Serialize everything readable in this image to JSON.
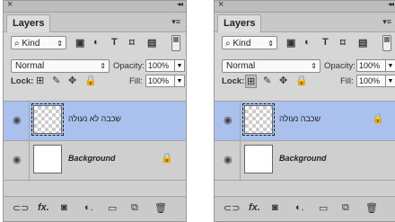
{
  "panels": [
    {
      "title": "Layers",
      "kind_label": "Kind",
      "blend_mode": "Normal",
      "opacity_label": "Opacity:",
      "opacity_value": "100%",
      "lock_label": "Lock:",
      "fill_label": "Fill:",
      "fill_value": "100%",
      "layers": [
        {
          "name": "שכבה לא נעולה",
          "selected": true,
          "locked": false
        },
        {
          "name": "Background",
          "selected": false,
          "locked": true
        }
      ]
    },
    {
      "title": "Layers",
      "kind_label": "Kind",
      "blend_mode": "Normal",
      "opacity_label": "Opacity:",
      "opacity_value": "100%",
      "lock_label": "Lock:",
      "fill_label": "Fill:",
      "fill_value": "100%",
      "layers": [
        {
          "name": "שכבה נעולה",
          "selected": true,
          "locked": true
        },
        {
          "name": "Background",
          "selected": false,
          "locked": false
        }
      ]
    }
  ],
  "icons": {
    "close": "×",
    "collapse": "«",
    "menu": "▾≡",
    "search": "⌕",
    "eye": "◉",
    "lock": "🔒",
    "fx": "fx"
  },
  "colors": {
    "panel_bg": "#d6d6d6",
    "selected_layer": "#a9c1ec"
  }
}
